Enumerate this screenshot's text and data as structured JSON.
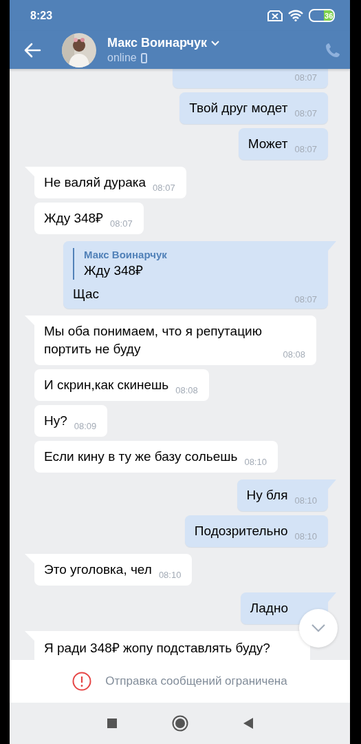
{
  "status_bar": {
    "time": "8:23",
    "battery": "36"
  },
  "header": {
    "name": "Макс Воинарчук",
    "presence": "online"
  },
  "messages": [
    {
      "kind": "text",
      "outgoing": true,
      "time": "08:07",
      "tail": false
    },
    {
      "kind": "text",
      "outgoing": true,
      "text": "Твой друг модет",
      "time": "08:07",
      "tail": false
    },
    {
      "kind": "text",
      "outgoing": true,
      "text": "Может",
      "time": "08:07",
      "tail": false
    },
    {
      "kind": "text",
      "outgoing": false,
      "text": "Не валяй дурака",
      "time": "08:07",
      "tail": true
    },
    {
      "kind": "text",
      "outgoing": false,
      "text": "Жду 348₽",
      "time": "08:07",
      "tail": false
    },
    {
      "kind": "reply",
      "outgoing": true,
      "quote_author": "Макс Воинарчук",
      "quote_text": "Жду 348₽",
      "text": "Щас",
      "time": "08:07",
      "tail": true
    },
    {
      "kind": "text",
      "outgoing": false,
      "text": "Мы оба понимаем, что я репутацию портить не буду",
      "time": "08:08",
      "tail": true
    },
    {
      "kind": "text",
      "outgoing": false,
      "text": "И скрин,как скинешь",
      "time": "08:08",
      "tail": false
    },
    {
      "kind": "text",
      "outgoing": false,
      "text": "Ну?",
      "time": "08:09",
      "tail": false
    },
    {
      "kind": "text",
      "outgoing": false,
      "text": "Если кину в ту же базу сольешь",
      "time": "08:10",
      "tail": false
    },
    {
      "kind": "text",
      "outgoing": true,
      "text": "Ну бля",
      "time": "08:10",
      "tail": true
    },
    {
      "kind": "text",
      "outgoing": true,
      "text": "Подозрительно",
      "time": "08:10",
      "tail": false
    },
    {
      "kind": "text",
      "outgoing": false,
      "text": "Это уголовка, чел",
      "time": "08:10",
      "tail": true
    },
    {
      "kind": "text",
      "outgoing": true,
      "text": "Ладно",
      "tail": true
    },
    {
      "kind": "text",
      "outgoing": false,
      "text": "Я ради 348₽ жопу подставлять буду?",
      "tail": true
    }
  ],
  "notice": {
    "text": "Отправка сообщений ограничена"
  }
}
